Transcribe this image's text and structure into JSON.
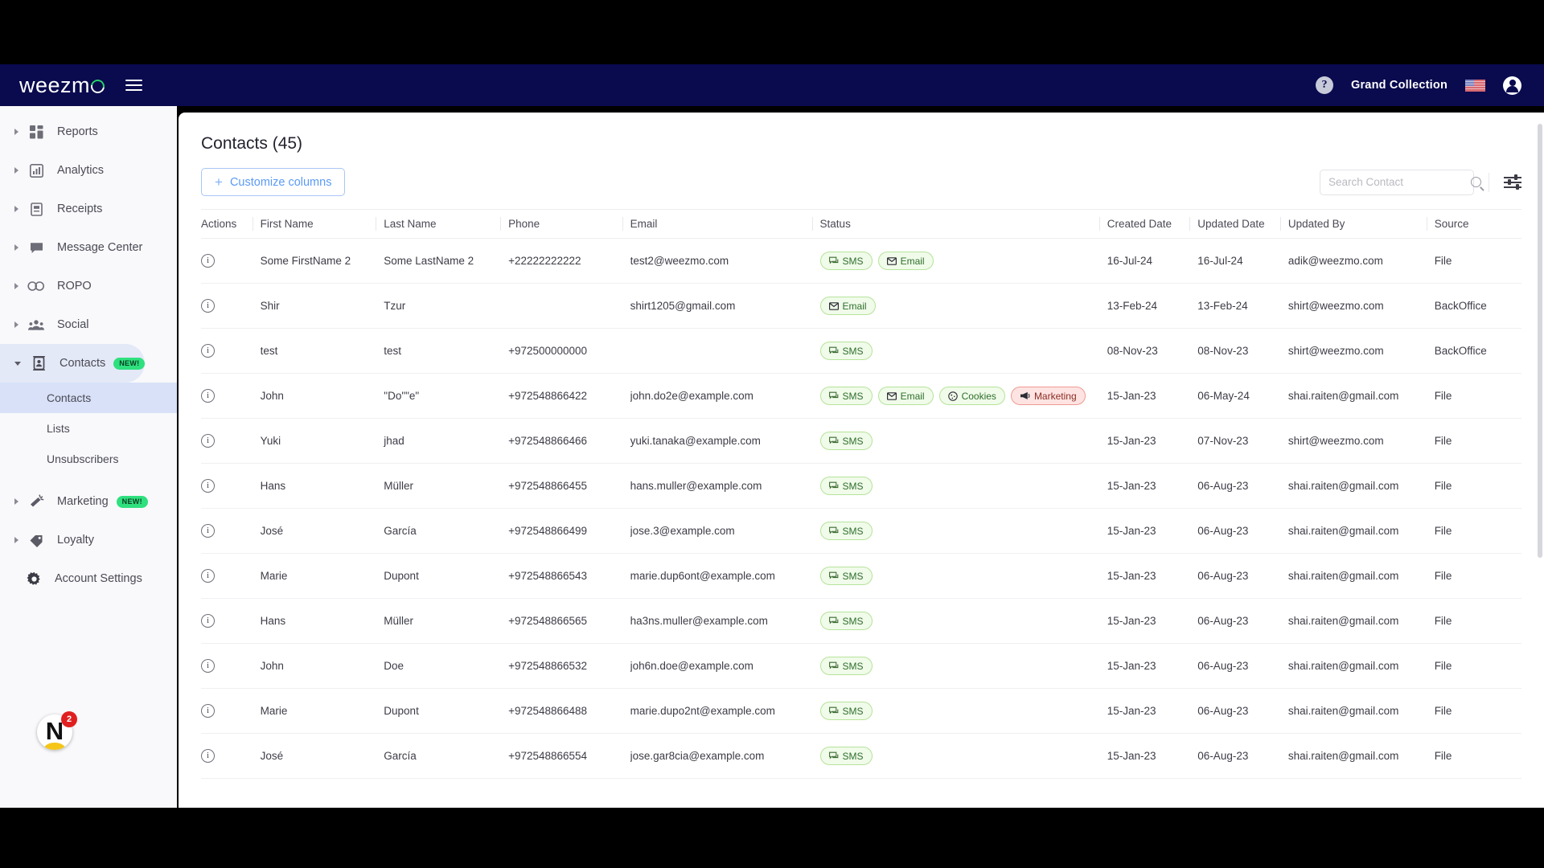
{
  "header": {
    "logo_text": "weezm",
    "logo_icon": "weezmo-logo",
    "menu_icon": "hamburger-menu-icon",
    "help_icon": "help-question-icon",
    "help_label": "?",
    "account_name": "Grand Collection",
    "flag_icon": "us-flag-icon",
    "avatar_icon": "user-avatar-icon"
  },
  "sidebar": {
    "items": [
      {
        "label": "Reports",
        "icon": "reports-grid-icon",
        "expandable": true,
        "expanded": false,
        "active": false,
        "badge": ""
      },
      {
        "label": "Analytics",
        "icon": "analytics-chart-icon",
        "expandable": true,
        "expanded": false,
        "active": false,
        "badge": ""
      },
      {
        "label": "Receipts",
        "icon": "receipts-icon",
        "expandable": true,
        "expanded": false,
        "active": false,
        "badge": ""
      },
      {
        "label": "Message Center",
        "icon": "message-bubble-icon",
        "expandable": true,
        "expanded": false,
        "active": false,
        "badge": ""
      },
      {
        "label": "ROPO",
        "icon": "ropo-infinity-icon",
        "expandable": true,
        "expanded": false,
        "active": false,
        "badge": ""
      },
      {
        "label": "Social",
        "icon": "social-people-icon",
        "expandable": true,
        "expanded": false,
        "active": false,
        "badge": ""
      },
      {
        "label": "Contacts",
        "icon": "contacts-card-icon",
        "expandable": true,
        "expanded": true,
        "active": true,
        "badge": "NEW!"
      }
    ],
    "contacts_subitems": [
      {
        "label": "Contacts",
        "active": true
      },
      {
        "label": "Lists",
        "active": false
      },
      {
        "label": "Unsubscribers",
        "active": false
      }
    ],
    "items_after": [
      {
        "label": "Marketing",
        "icon": "marketing-megaphone-icon",
        "expandable": true,
        "expanded": false,
        "active": false,
        "badge": "NEW!"
      },
      {
        "label": "Loyalty",
        "icon": "loyalty-tag-icon",
        "expandable": true,
        "expanded": false,
        "active": false,
        "badge": ""
      },
      {
        "label": "Account Settings",
        "icon": "gear-icon",
        "expandable": false,
        "expanded": false,
        "active": false,
        "badge": ""
      }
    ],
    "dock": {
      "letter": "N",
      "badge_count": "2",
      "icon": "notion-app-icon"
    }
  },
  "main": {
    "page_title": "Contacts (45)",
    "customize_button": "Customize columns",
    "customize_icon": "plus-icon",
    "search": {
      "placeholder": "Search Contact",
      "value": "",
      "icon": "search-icon"
    },
    "filter_icon": "filter-sliders-icon",
    "columns": [
      "Actions",
      "First Name",
      "Last Name",
      "Phone",
      "Email",
      "Status",
      "Created Date",
      "Updated Date",
      "Updated By",
      "Source"
    ],
    "rows": [
      {
        "first_name": "Some FirstName 2",
        "last_name": "Some LastName 2",
        "phone": "+22222222222",
        "email": "test2@weezmo.com",
        "status": [
          {
            "label": "SMS",
            "type": "green",
            "icon": "sms-icon"
          },
          {
            "label": "Email",
            "type": "green",
            "icon": "email-icon"
          }
        ],
        "created": "16-Jul-24",
        "updated": "16-Jul-24",
        "updated_by": "adik@weezmo.com",
        "source": "File"
      },
      {
        "first_name": "Shir",
        "last_name": "Tzur",
        "phone": "",
        "email": "shirt1205@gmail.com",
        "status": [
          {
            "label": "Email",
            "type": "green",
            "icon": "email-icon"
          }
        ],
        "created": "13-Feb-24",
        "updated": "13-Feb-24",
        "updated_by": "shirt@weezmo.com",
        "source": "BackOffice"
      },
      {
        "first_name": "test",
        "last_name": "test",
        "phone": "+972500000000",
        "email": "",
        "status": [
          {
            "label": "SMS",
            "type": "green",
            "icon": "sms-icon"
          }
        ],
        "created": "08-Nov-23",
        "updated": "08-Nov-23",
        "updated_by": "shirt@weezmo.com",
        "source": "BackOffice"
      },
      {
        "first_name": "John",
        "last_name": "\"Do\"\"e\"",
        "phone": "+972548866422",
        "email": "john.do2e@example.com",
        "status": [
          {
            "label": "SMS",
            "type": "green",
            "icon": "sms-icon"
          },
          {
            "label": "Email",
            "type": "green",
            "icon": "email-icon"
          },
          {
            "label": "Cookies",
            "type": "green",
            "icon": "cookie-icon"
          },
          {
            "label": "Marketing",
            "type": "red",
            "icon": "megaphone-icon"
          }
        ],
        "created": "15-Jan-23",
        "updated": "06-May-24",
        "updated_by": "shai.raiten@gmail.com",
        "source": "File"
      },
      {
        "first_name": "Yuki",
        "last_name": "jhad",
        "phone": "+972548866466",
        "email": "yuki.tanaka@example.com",
        "status": [
          {
            "label": "SMS",
            "type": "green",
            "icon": "sms-icon"
          }
        ],
        "created": "15-Jan-23",
        "updated": "07-Nov-23",
        "updated_by": "shirt@weezmo.com",
        "source": "File"
      },
      {
        "first_name": "Hans",
        "last_name": "Müller",
        "phone": "+972548866455",
        "email": "hans.muller@example.com",
        "status": [
          {
            "label": "SMS",
            "type": "green",
            "icon": "sms-icon"
          }
        ],
        "created": "15-Jan-23",
        "updated": "06-Aug-23",
        "updated_by": "shai.raiten@gmail.com",
        "source": "File"
      },
      {
        "first_name": "José",
        "last_name": "García",
        "phone": "+972548866499",
        "email": "jose.3@example.com",
        "status": [
          {
            "label": "SMS",
            "type": "green",
            "icon": "sms-icon"
          }
        ],
        "created": "15-Jan-23",
        "updated": "06-Aug-23",
        "updated_by": "shai.raiten@gmail.com",
        "source": "File"
      },
      {
        "first_name": "Marie",
        "last_name": "Dupont",
        "phone": "+972548866543",
        "email": "marie.dup6ont@example.com",
        "status": [
          {
            "label": "SMS",
            "type": "green",
            "icon": "sms-icon"
          }
        ],
        "created": "15-Jan-23",
        "updated": "06-Aug-23",
        "updated_by": "shai.raiten@gmail.com",
        "source": "File"
      },
      {
        "first_name": "Hans",
        "last_name": "Müller",
        "phone": "+972548866565",
        "email": "ha3ns.muller@example.com",
        "status": [
          {
            "label": "SMS",
            "type": "green",
            "icon": "sms-icon"
          }
        ],
        "created": "15-Jan-23",
        "updated": "06-Aug-23",
        "updated_by": "shai.raiten@gmail.com",
        "source": "File"
      },
      {
        "first_name": "John",
        "last_name": "Doe",
        "phone": "+972548866532",
        "email": "joh6n.doe@example.com",
        "status": [
          {
            "label": "SMS",
            "type": "green",
            "icon": "sms-icon"
          }
        ],
        "created": "15-Jan-23",
        "updated": "06-Aug-23",
        "updated_by": "shai.raiten@gmail.com",
        "source": "File"
      },
      {
        "first_name": "Marie",
        "last_name": "Dupont",
        "phone": "+972548866488",
        "email": "marie.dupo2nt@example.com",
        "status": [
          {
            "label": "SMS",
            "type": "green",
            "icon": "sms-icon"
          }
        ],
        "created": "15-Jan-23",
        "updated": "06-Aug-23",
        "updated_by": "shai.raiten@gmail.com",
        "source": "File"
      },
      {
        "first_name": "José",
        "last_name": "García",
        "phone": "+972548866554",
        "email": "jose.gar8cia@example.com",
        "status": [
          {
            "label": "SMS",
            "type": "green",
            "icon": "sms-icon"
          }
        ],
        "created": "15-Jan-23",
        "updated": "06-Aug-23",
        "updated_by": "shai.raiten@gmail.com",
        "source": "File"
      }
    ],
    "row_action_icon": "info-icon"
  },
  "colors": {
    "header_bg": "#0a0a4f",
    "accent_blue": "#5b9af5",
    "badge_green": "#2fe07e",
    "chip_green_bg": "#f0fbea",
    "chip_red_bg": "#fde4e2",
    "sidebar_active": "#d8e1f7"
  }
}
